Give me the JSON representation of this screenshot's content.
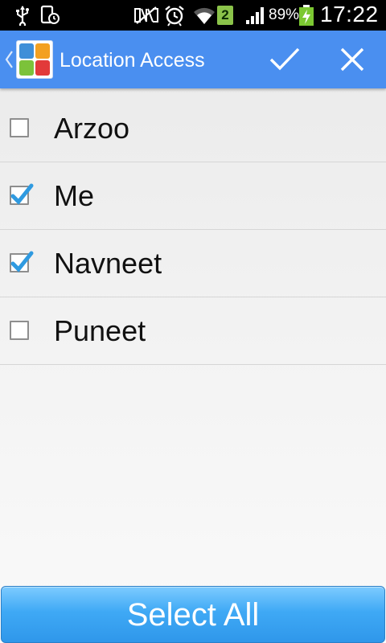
{
  "status_bar": {
    "sim_number": "2",
    "battery_percent": "89%",
    "time": "17:22",
    "icons": [
      "usb-icon",
      "screenshot-icon",
      "nfc-icon",
      "alarm-icon",
      "wifi-icon",
      "signal-icon",
      "battery-charging-icon"
    ]
  },
  "action_bar": {
    "title": "Location Access",
    "background_color": "#4a8ff0",
    "icons": [
      "back-chevron-icon",
      "app-icon",
      "checkmark-icon",
      "close-icon"
    ]
  },
  "contacts": [
    {
      "name": "Arzoo",
      "checked": false
    },
    {
      "name": "Me",
      "checked": true
    },
    {
      "name": "Navneet",
      "checked": true
    },
    {
      "name": "Puneet",
      "checked": false
    }
  ],
  "footer": {
    "select_all_label": "Select All"
  }
}
